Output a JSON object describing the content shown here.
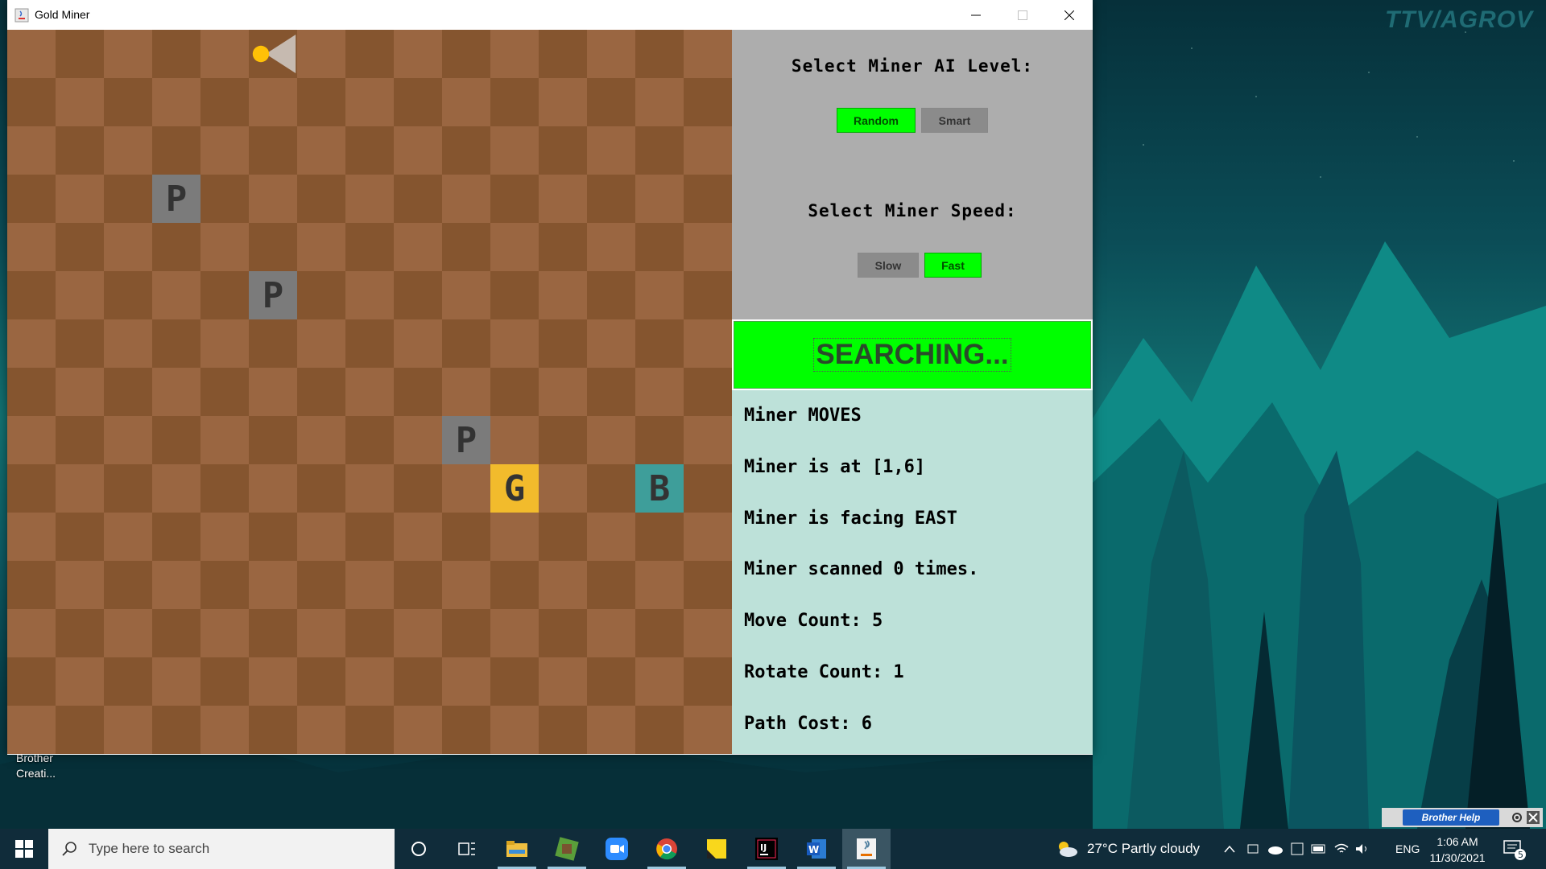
{
  "window": {
    "title": "Gold Miner",
    "controls": [
      "minimize",
      "maximize",
      "close"
    ]
  },
  "board": {
    "grid_size": 15,
    "colors": {
      "light": "#9a6641",
      "dark": "#85552f",
      "pit": "#7b7b7b",
      "gold": "#f2bb2c",
      "beacon": "#3e9e9a",
      "miner": "#ffc107"
    },
    "miner": {
      "row": 1,
      "col": 6,
      "facing": "EAST"
    },
    "tiles": [
      {
        "type": "pit",
        "label": "P",
        "row": 4,
        "col": 4
      },
      {
        "type": "pit",
        "label": "P",
        "row": 6,
        "col": 6
      },
      {
        "type": "pit",
        "label": "P",
        "row": 9,
        "col": 10
      },
      {
        "type": "gold",
        "label": "G",
        "row": 10,
        "col": 11
      },
      {
        "type": "beacon",
        "label": "B",
        "row": 10,
        "col": 14
      }
    ]
  },
  "controls": {
    "ai_title": "Select Miner AI Level:",
    "ai_options": [
      {
        "label": "Random",
        "selected": true
      },
      {
        "label": "Smart",
        "selected": false
      }
    ],
    "speed_title": "Select Miner Speed:",
    "speed_options": [
      {
        "label": "Slow",
        "selected": false
      },
      {
        "label": "Fast",
        "selected": true
      }
    ]
  },
  "status": {
    "text": "SEARCHING...",
    "color": "#00ff00"
  },
  "info": {
    "action": "Miner MOVES",
    "position": "Miner is at [1,6]",
    "facing": "Miner is facing EAST",
    "scanned": "Miner scanned 0 times.",
    "move_count": "Move Count: 5",
    "rotate_count": "Rotate Count: 1",
    "path_cost": "Path Cost: 6"
  },
  "desktop": {
    "watermark": "TTV/AGROV",
    "shortcut_label_1": "Brother",
    "shortcut_label_2": "Creati...",
    "brother_help": "Brother Help"
  },
  "taskbar": {
    "search_placeholder": "Type here to search",
    "apps": [
      "cortana-icon",
      "task-view-icon",
      "file-explorer-icon",
      "minecraft-icon",
      "zoom-icon",
      "chrome-icon",
      "sticky-notes-icon",
      "intellij-icon",
      "word-icon",
      "java-icon"
    ],
    "weather": "27°C  Partly cloudy",
    "language": "ENG",
    "time": "1:06 AM",
    "date": "11/30/2021",
    "notification_count": "5"
  }
}
